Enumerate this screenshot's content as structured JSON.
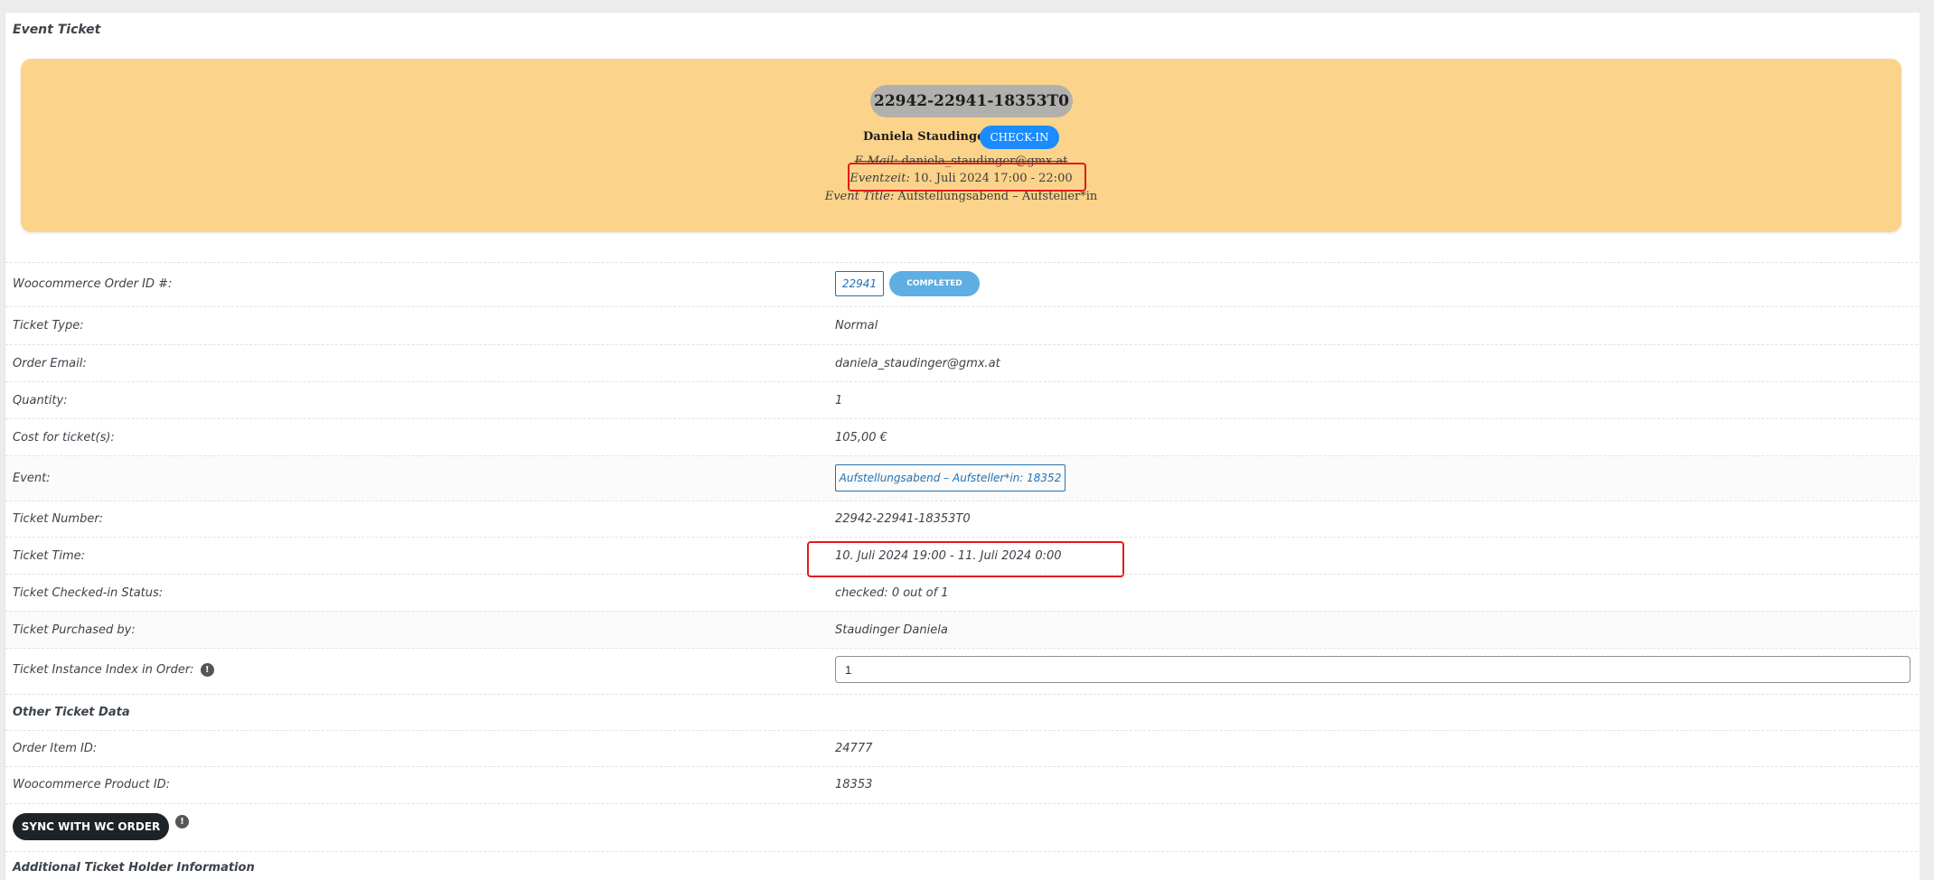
{
  "section": {
    "title": "Event Ticket"
  },
  "ticket_card": {
    "ticket_number": "22942-22941-18353T0",
    "holder_name": "Daniela Staudinger",
    "checkin_label": "CHECK-IN",
    "email_label": "E-Mail:",
    "email_value": "daniela_staudinger@gmx.at",
    "eventzeit_label": "Eventzeit:",
    "eventzeit_value": "10. Juli 2024 17:00 - 22:00",
    "event_title_label": "Event Title:",
    "event_title_value": "Aufstellungsabend – Aufsteller*in"
  },
  "details": {
    "order_id_label": "Woocommerce Order ID #:",
    "order_id": "22941",
    "order_status": "COMPLETED",
    "ticket_type_label": "Ticket Type:",
    "ticket_type": "Normal",
    "order_email_label": "Order Email:",
    "order_email": "daniela_staudinger@gmx.at",
    "quantity_label": "Quantity:",
    "quantity": "1",
    "cost_label": "Cost for ticket(s):",
    "cost": "105,00 €",
    "event_label": "Event:",
    "event_value": "Aufstellungsabend – Aufsteller*in: 18352",
    "ticket_number_label": "Ticket Number:",
    "ticket_number": "22942-22941-18353T0",
    "ticket_time_label": "Ticket Time:",
    "ticket_time": "10. Juli 2024 19:00 - 11. Juli 2024 0:00",
    "checked_in_label": "Ticket Checked-in Status:",
    "checked_in": "checked: 0 out of 1",
    "purchased_by_label": "Ticket Purchased by:",
    "purchased_by": "Staudinger Daniela",
    "instance_index_label": "Ticket Instance Index in Order:",
    "instance_index": "1"
  },
  "other": {
    "title": "Other Ticket Data",
    "order_item_label": "Order Item ID:",
    "order_item": "24777",
    "product_id_label": "Woocommerce Product ID:",
    "product_id": "18353",
    "sync_button": "SYNC WITH WC ORDER"
  },
  "additional": {
    "title": "Additional Ticket Holder Information"
  },
  "icons": {
    "info": "info-icon"
  },
  "colors": {
    "card_bg": "#fcd38a",
    "checkin": "#1a8cff",
    "status": "#5faee3",
    "link": "#2271b1",
    "highlight": "#e11b1b"
  }
}
